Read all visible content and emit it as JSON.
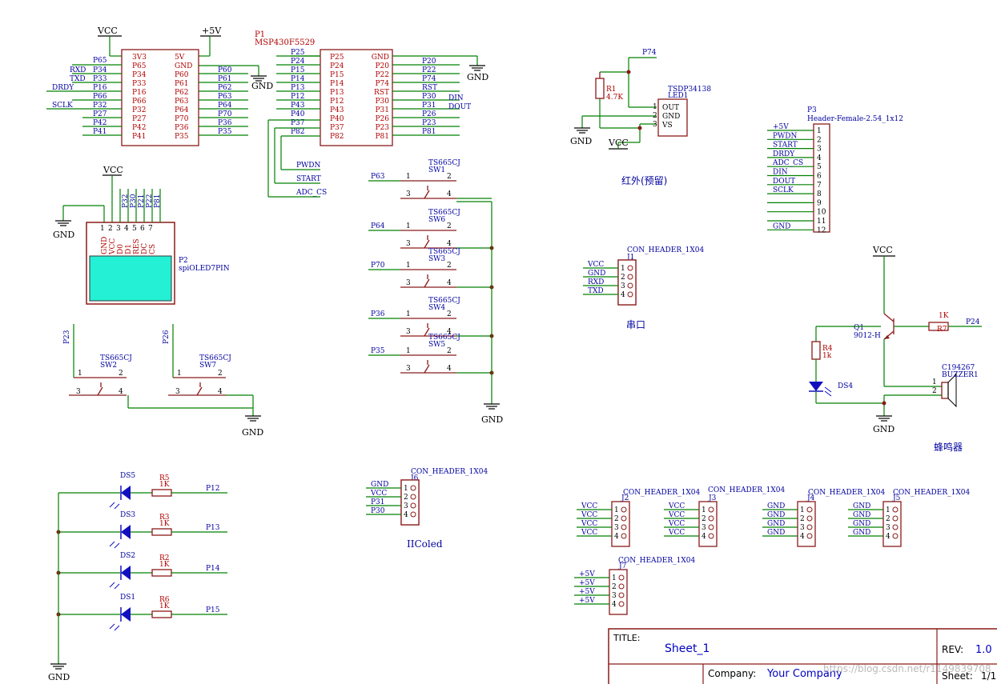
{
  "power": {
    "vcc": "VCC",
    "p5v": "+5V",
    "gnd": "GND"
  },
  "mcu": {
    "ref": "P1",
    "part": "MSP430F5529",
    "left_pins": [
      "3V3",
      "P65",
      "P34",
      "P33",
      "P16",
      "P66",
      "P32",
      "P27",
      "P42",
      "P41"
    ],
    "left_right_pins": [
      "5V",
      "GND",
      "P60",
      "P61",
      "P62",
      "P63",
      "P64",
      "P70",
      "P36",
      "P35"
    ],
    "left_nets_in": [
      "P65",
      "RXD",
      "TXD",
      "DRDY",
      "",
      "SCLK"
    ],
    "left_in_pins": [
      "P34",
      "P33",
      "P16",
      "P66",
      "P32",
      "P27",
      "P42",
      "P41"
    ],
    "left_out_nets": [
      "P60",
      "P61",
      "P62",
      "P63",
      "P64",
      "P70",
      "P36",
      "P35"
    ],
    "right_left_pins": [
      "P25",
      "P24",
      "P15",
      "P14",
      "P13",
      "P12",
      "P43",
      "P40",
      "P37",
      "P82"
    ],
    "right_right_pins": [
      "GND",
      "P20",
      "P22",
      "P74",
      "RST",
      "P30",
      "P31",
      "P26",
      "P23",
      "P81"
    ],
    "right_in_nets": [
      "P25",
      "P24",
      "P15",
      "P14",
      "P13",
      "P12",
      "P43",
      "P40",
      "P37",
      "P82"
    ],
    "right_out_nets": [
      "P20",
      "P22",
      "P74",
      "RST",
      "P30",
      "P31",
      "P26",
      "P23",
      "P81"
    ],
    "din": "DIN",
    "dout": "DOUT",
    "pwdn": "PWDN",
    "start": "START",
    "adc_cs": "ADC_CS"
  },
  "oled": {
    "ref": "P2",
    "part": "spiOLED7PIN",
    "pin_names": [
      "GND",
      "VCC",
      "D0",
      "D1",
      "RES",
      "DC",
      "CS"
    ],
    "pin_nums": [
      "1",
      "2",
      "3",
      "4",
      "5",
      "6",
      "7"
    ],
    "nets": [
      "P32",
      "P30",
      "P21",
      "P22",
      "P81"
    ]
  },
  "switches": [
    {
      "ref": "SW1",
      "part": "TS665CJ",
      "net": "P63"
    },
    {
      "ref": "SW6",
      "part": "TS665CJ",
      "net": "P64"
    },
    {
      "ref": "SW3",
      "part": "TS665CJ",
      "net": "P70"
    },
    {
      "ref": "SW4",
      "part": "TS665CJ",
      "net": "P36"
    },
    {
      "ref": "SW5",
      "part": "TS665CJ",
      "net": "P35"
    }
  ],
  "switches_low": [
    {
      "ref": "SW2",
      "part": "TS665CJ",
      "net": "P23"
    },
    {
      "ref": "SW7",
      "part": "TS665CJ",
      "net": "P26"
    }
  ],
  "sw_pins": [
    "1",
    "2",
    "3",
    "4"
  ],
  "ir": {
    "ref": "LED1",
    "part": "TSDP34138",
    "r": "R1",
    "rv": "4.7K",
    "net": "P74",
    "pins": [
      "OUT",
      "GND",
      "VS"
    ],
    "nums": [
      "1",
      "2",
      "3"
    ],
    "caption": "红外(预留)"
  },
  "p3": {
    "ref": "P3",
    "part": "Header-Female-2.54_1x12",
    "nets": [
      "+5V",
      "PWDN",
      "START",
      "DRDY",
      "ADC_CS",
      "DIN",
      "DOUT",
      "SCLK",
      "",
      "",
      "",
      "GND"
    ],
    "nums": [
      "1",
      "2",
      "3",
      "4",
      "5",
      "6",
      "7",
      "8",
      "9",
      "10",
      "11",
      "12"
    ]
  },
  "j1": {
    "ref": "J1",
    "part": "CON_HEADER_1X04",
    "nets": [
      "VCC",
      "GND",
      "RXD",
      "TXD"
    ],
    "caption": "串口"
  },
  "buzzer": {
    "q": "Q1",
    "qpart": "9012-H",
    "r7": "R7",
    "r7v": "1K",
    "r4": "R4",
    "r4v": "1k",
    "ds": "DS4",
    "bz": "BUZZER1",
    "bzpart": "C194267",
    "net": "P24",
    "caption": "蜂鸣器",
    "p1": "1",
    "p2": "2"
  },
  "leds": [
    {
      "ds": "DS5",
      "r": "R5",
      "rv": "1K",
      "net": "P12"
    },
    {
      "ds": "DS3",
      "r": "R3",
      "rv": "1K",
      "net": "P13"
    },
    {
      "ds": "DS2",
      "r": "R2",
      "rv": "1K",
      "net": "P14"
    },
    {
      "ds": "DS1",
      "r": "R6",
      "rv": "1K",
      "net": "P15"
    }
  ],
  "j6": {
    "ref": "J6",
    "part": "CON_HEADER_1X04",
    "nets": [
      "GND",
      "VCC",
      "P31",
      "P30"
    ],
    "caption": "IIColed"
  },
  "j2": {
    "ref": "J2",
    "part": "CON_HEADER_1X04",
    "nets": [
      "VCC",
      "VCC",
      "VCC",
      "VCC"
    ]
  },
  "j3": {
    "ref": "J3",
    "part": "CON_HEADER_1X04",
    "nets": [
      "VCC",
      "VCC",
      "VCC",
      "VCC"
    ]
  },
  "j4": {
    "ref": "J4",
    "part": "CON_HEADER_1X04",
    "nets": [
      "GND",
      "GND",
      "GND",
      "GND"
    ]
  },
  "j5": {
    "ref": "J5",
    "part": "CON_HEADER_1X04",
    "nets": [
      "GND",
      "GND",
      "GND",
      "GND"
    ]
  },
  "j7": {
    "ref": "J7",
    "part": "CON_HEADER_1X04",
    "nets": [
      "+5V",
      "+5V",
      "+5V",
      "+5V"
    ]
  },
  "hnums": [
    "1",
    "2",
    "3",
    "4"
  ],
  "titleblock": {
    "title_label": "TITLE:",
    "title": "Sheet_1",
    "rev_label": "REV:",
    "rev": "1.0",
    "company_label": "Company:",
    "company": "Your Company",
    "sheet_label": "Sheet:",
    "sheet": "1/1",
    "watermark": "https://blog.csdn.net/r1149839708"
  }
}
